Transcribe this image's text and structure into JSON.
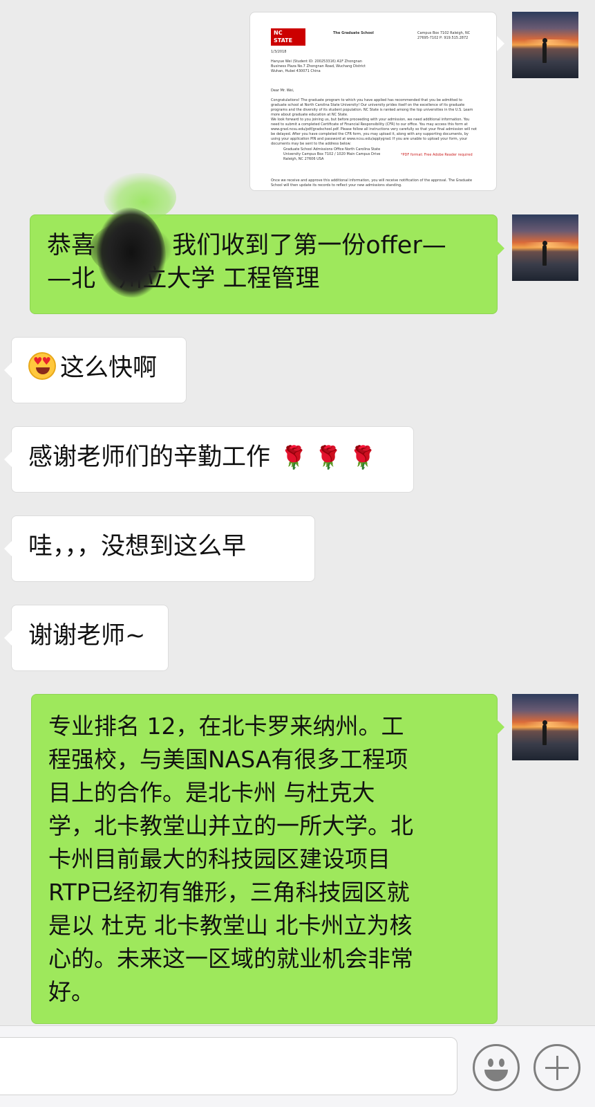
{
  "messages": {
    "offer_image": {
      "logo_text": "NC STATE UNIVERSITY",
      "header_left": "The Graduate School",
      "header_right": "Campus Box 7102 Raleigh, NC 27695-7102 P: 919.515.2872",
      "date": "1/3/2018",
      "recipient": "Hanyue Wei (Student ID: 200253316) A1F Zhongnan Business Plaza No.7 Zhongnan Road, Wuchang District Wuhan, Hubei 430071 China",
      "salutation": "Dear Mr. Wei,",
      "para1": "Congratulations! The graduate program to which you have applied has recommended that you be admitted to graduate school at North Carolina State University! Our university prides itself on the excellence of its graduate programs and the diversity of its student population. NC State is ranked among the top universities in the U.S. Learn more about graduate education at NC State.",
      "para2": "We look forward to you joining us, but before proceeding with your admission, we need additional information. You need to submit a completed Certificate of Financial Responsibility (CFR) to our office. You may access this form at www.grad.ncsu.edu/pdf/gradschool.pdf. Please follow all instructions very carefully so that your final admission will not be delayed. After you have completed the CFR form, you may upload it, along with any supporting documents, by using your application PIN and password at www.ncsu.edu/applygrad. If you are unable to upload your form, your documents may be sent to the address below:",
      "office": "Graduate School Admissions Office North Carolina State University Campus Box 7102 / 1020 Main Campus Drive Raleigh, NC 27606 USA",
      "pdf_note": "*PDF format: Free Adobe Reader required",
      "para3": "Once we receive and approve this additional information, you will receive notification of the approval. The Graduate School will then update its records to reflect your new admissions standing."
    },
    "m1_line1": "恭喜          我们收到了第一份offer—",
    "m1_line2": "—北   州立大学 工程管理",
    "m2": "这么快啊",
    "m3": "感谢老师们的辛勤工作",
    "m3_roses": "🌹 🌹 🌹",
    "m4": "哇，，，没想到这么早",
    "m5": "谢谢老师~",
    "m6_lines": [
      "专业排名 12，在北卡罗来纳州。工",
      "程强校，与美国NASA有很多工程项",
      "目上的合作。是北卡州 与杜克大",
      "学，北卡教堂山并立的一所大学。北",
      "卡州目前最大的科技园区建设项目",
      "RTP已经初有雏形，三角科技园区就",
      "是以 杜克 北卡教堂山 北卡州立为核",
      "心的。未来这一区域的就业机会非常",
      "好。"
    ]
  },
  "input_bar": {
    "emoji_icon": "smiley-face",
    "plus_icon": "plus"
  },
  "colors": {
    "background": "#ebebeb",
    "my_bubble": "#9ee85c",
    "their_bubble": "#ffffff"
  }
}
